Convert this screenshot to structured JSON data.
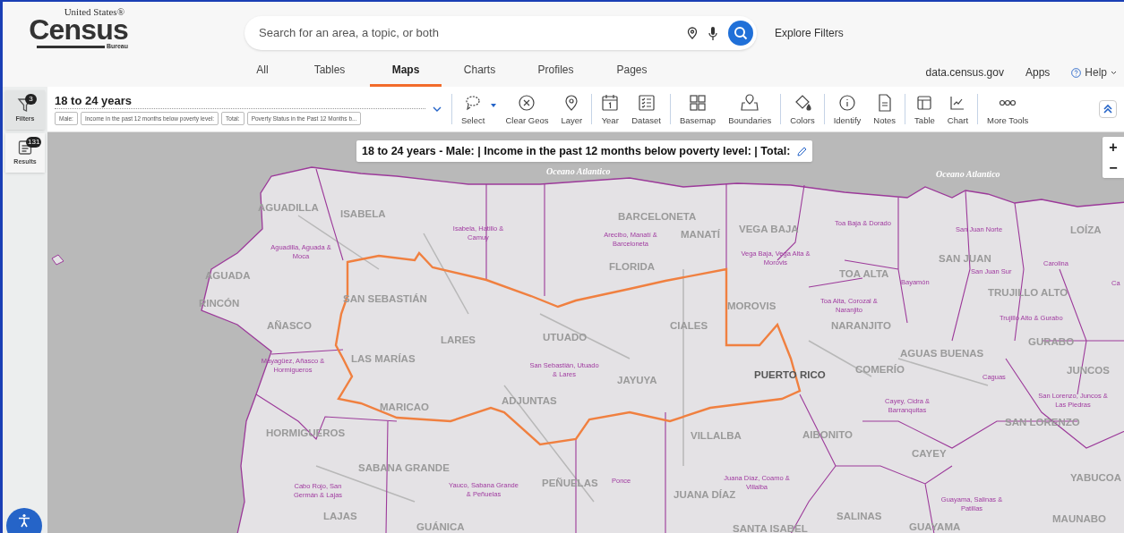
{
  "logo": {
    "top": "United States®",
    "main": "Census",
    "bottom": "Bureau"
  },
  "search": {
    "placeholder": "Search for an area, a topic, or both"
  },
  "explore_filters": "Explore Filters",
  "tabs": [
    {
      "label": "All",
      "selected": false
    },
    {
      "label": "Tables",
      "selected": false
    },
    {
      "label": "Maps",
      "selected": true
    },
    {
      "label": "Charts",
      "selected": false
    },
    {
      "label": "Profiles",
      "selected": false
    },
    {
      "label": "Pages",
      "selected": false
    }
  ],
  "header_links": [
    {
      "label": "data.census.gov",
      "kind": "link"
    },
    {
      "label": "Apps",
      "kind": "link"
    },
    {
      "label": "Help",
      "kind": "help"
    }
  ],
  "left_rail": [
    {
      "label": "Filters",
      "badge": "3",
      "kind": "filter"
    },
    {
      "label": "Results",
      "badge": "131",
      "kind": "results"
    }
  ],
  "filter": {
    "title": "18 to 24 years",
    "chips": [
      "Male:",
      "Income in the past 12 months below poverty level:",
      "Total:",
      "Poverty Status in the Past 12 Months b..."
    ]
  },
  "tools": [
    {
      "label": "Select",
      "kind": "select",
      "dropdown": true
    },
    {
      "label": "Clear Geos",
      "kind": "clear",
      "dropdown": false
    },
    {
      "label": "Layer",
      "kind": "pin",
      "dropdown": false
    },
    {
      "label": "Year",
      "kind": "calendar",
      "dropdown": false
    },
    {
      "label": "Dataset",
      "kind": "list",
      "dropdown": false
    },
    {
      "label": "Basemap",
      "kind": "grid",
      "dropdown": false
    },
    {
      "label": "Boundaries",
      "kind": "boundaries",
      "dropdown": false
    },
    {
      "label": "Colors",
      "kind": "bucket",
      "dropdown": false
    },
    {
      "label": "Identify",
      "kind": "info",
      "dropdown": false
    },
    {
      "label": "Notes",
      "kind": "doc",
      "dropdown": false
    },
    {
      "label": "Table",
      "kind": "table",
      "dropdown": false
    },
    {
      "label": "Chart",
      "kind": "chart",
      "dropdown": false
    },
    {
      "label": "More Tools",
      "kind": "more",
      "dropdown": false
    }
  ],
  "map": {
    "title": "18 to 24 years - Male: | Income in the past 12 months below poverty level: | Total:",
    "zoom": [
      "+",
      "−"
    ],
    "ocean_labels": [
      "Oceano Atlantico",
      "Oceano Atlantico"
    ],
    "highlight_label": "PUERTO RICO",
    "municipalities": [
      "AGUADILLA",
      "ISABELA",
      "AGUADA",
      "RINCÓN",
      "AÑASCO",
      "SAN SEBASTIÁN",
      "LARES",
      "UTUADO",
      "CIALES",
      "MOROVIS",
      "BARCELONETA",
      "MANATÍ",
      "FLORIDA",
      "VEGA BAJA",
      "TOA ALTA",
      "NARANJITO",
      "SAN JUAN",
      "TRUJILLO ALTO",
      "GURABO",
      "AGUAS BUENAS",
      "COMERÍO",
      "LAS MARÍAS",
      "MARICAO",
      "ADJUNTAS",
      "JAYUYA",
      "VILLALBA",
      "AIBONITO",
      "CAYEY",
      "JUNCOS",
      "SAN LORENZO",
      "YABUCOA",
      "SALINAS",
      "MAUNABO",
      "SANTA ISABEL",
      "GUAYAMA",
      "JUANA DÍAZ",
      "PEÑUELAS",
      "SABANA GRANDE",
      "HORMIGUEROS",
      "LAJAS",
      "GUÁNICA",
      "LOÍZA"
    ],
    "regions": [
      "Aguadilla, Aguada & Moca",
      "Isabela, Hatillo & Camuy",
      "Arecibo, Manatí & Barceloneta",
      "Vega Baja, Vega Alta & Morovis",
      "Toa Baja & Dorado",
      "San Juan Norte",
      "San Juan Sur",
      "Carolina",
      "Bayamón",
      "Toa Alta, Corozal & Naranjito",
      "Trujillo Alto & Gurabo",
      "Caguas",
      "San Lorenzo, Juncos & Las Piedras",
      "Cayey, Cidra & Barranquitas",
      "Mayagüez, Añasco & Hormigueros",
      "San Sebastián, Utuado & Lares",
      "Cabo Rojo, San Germán & Lajas",
      "Yauco, Sabana Grande & Peñuelas",
      "Ponce",
      "Juana Díaz, Coamo & Villalba",
      "Guayama, Salinas & Patillas",
      "Ca"
    ]
  }
}
